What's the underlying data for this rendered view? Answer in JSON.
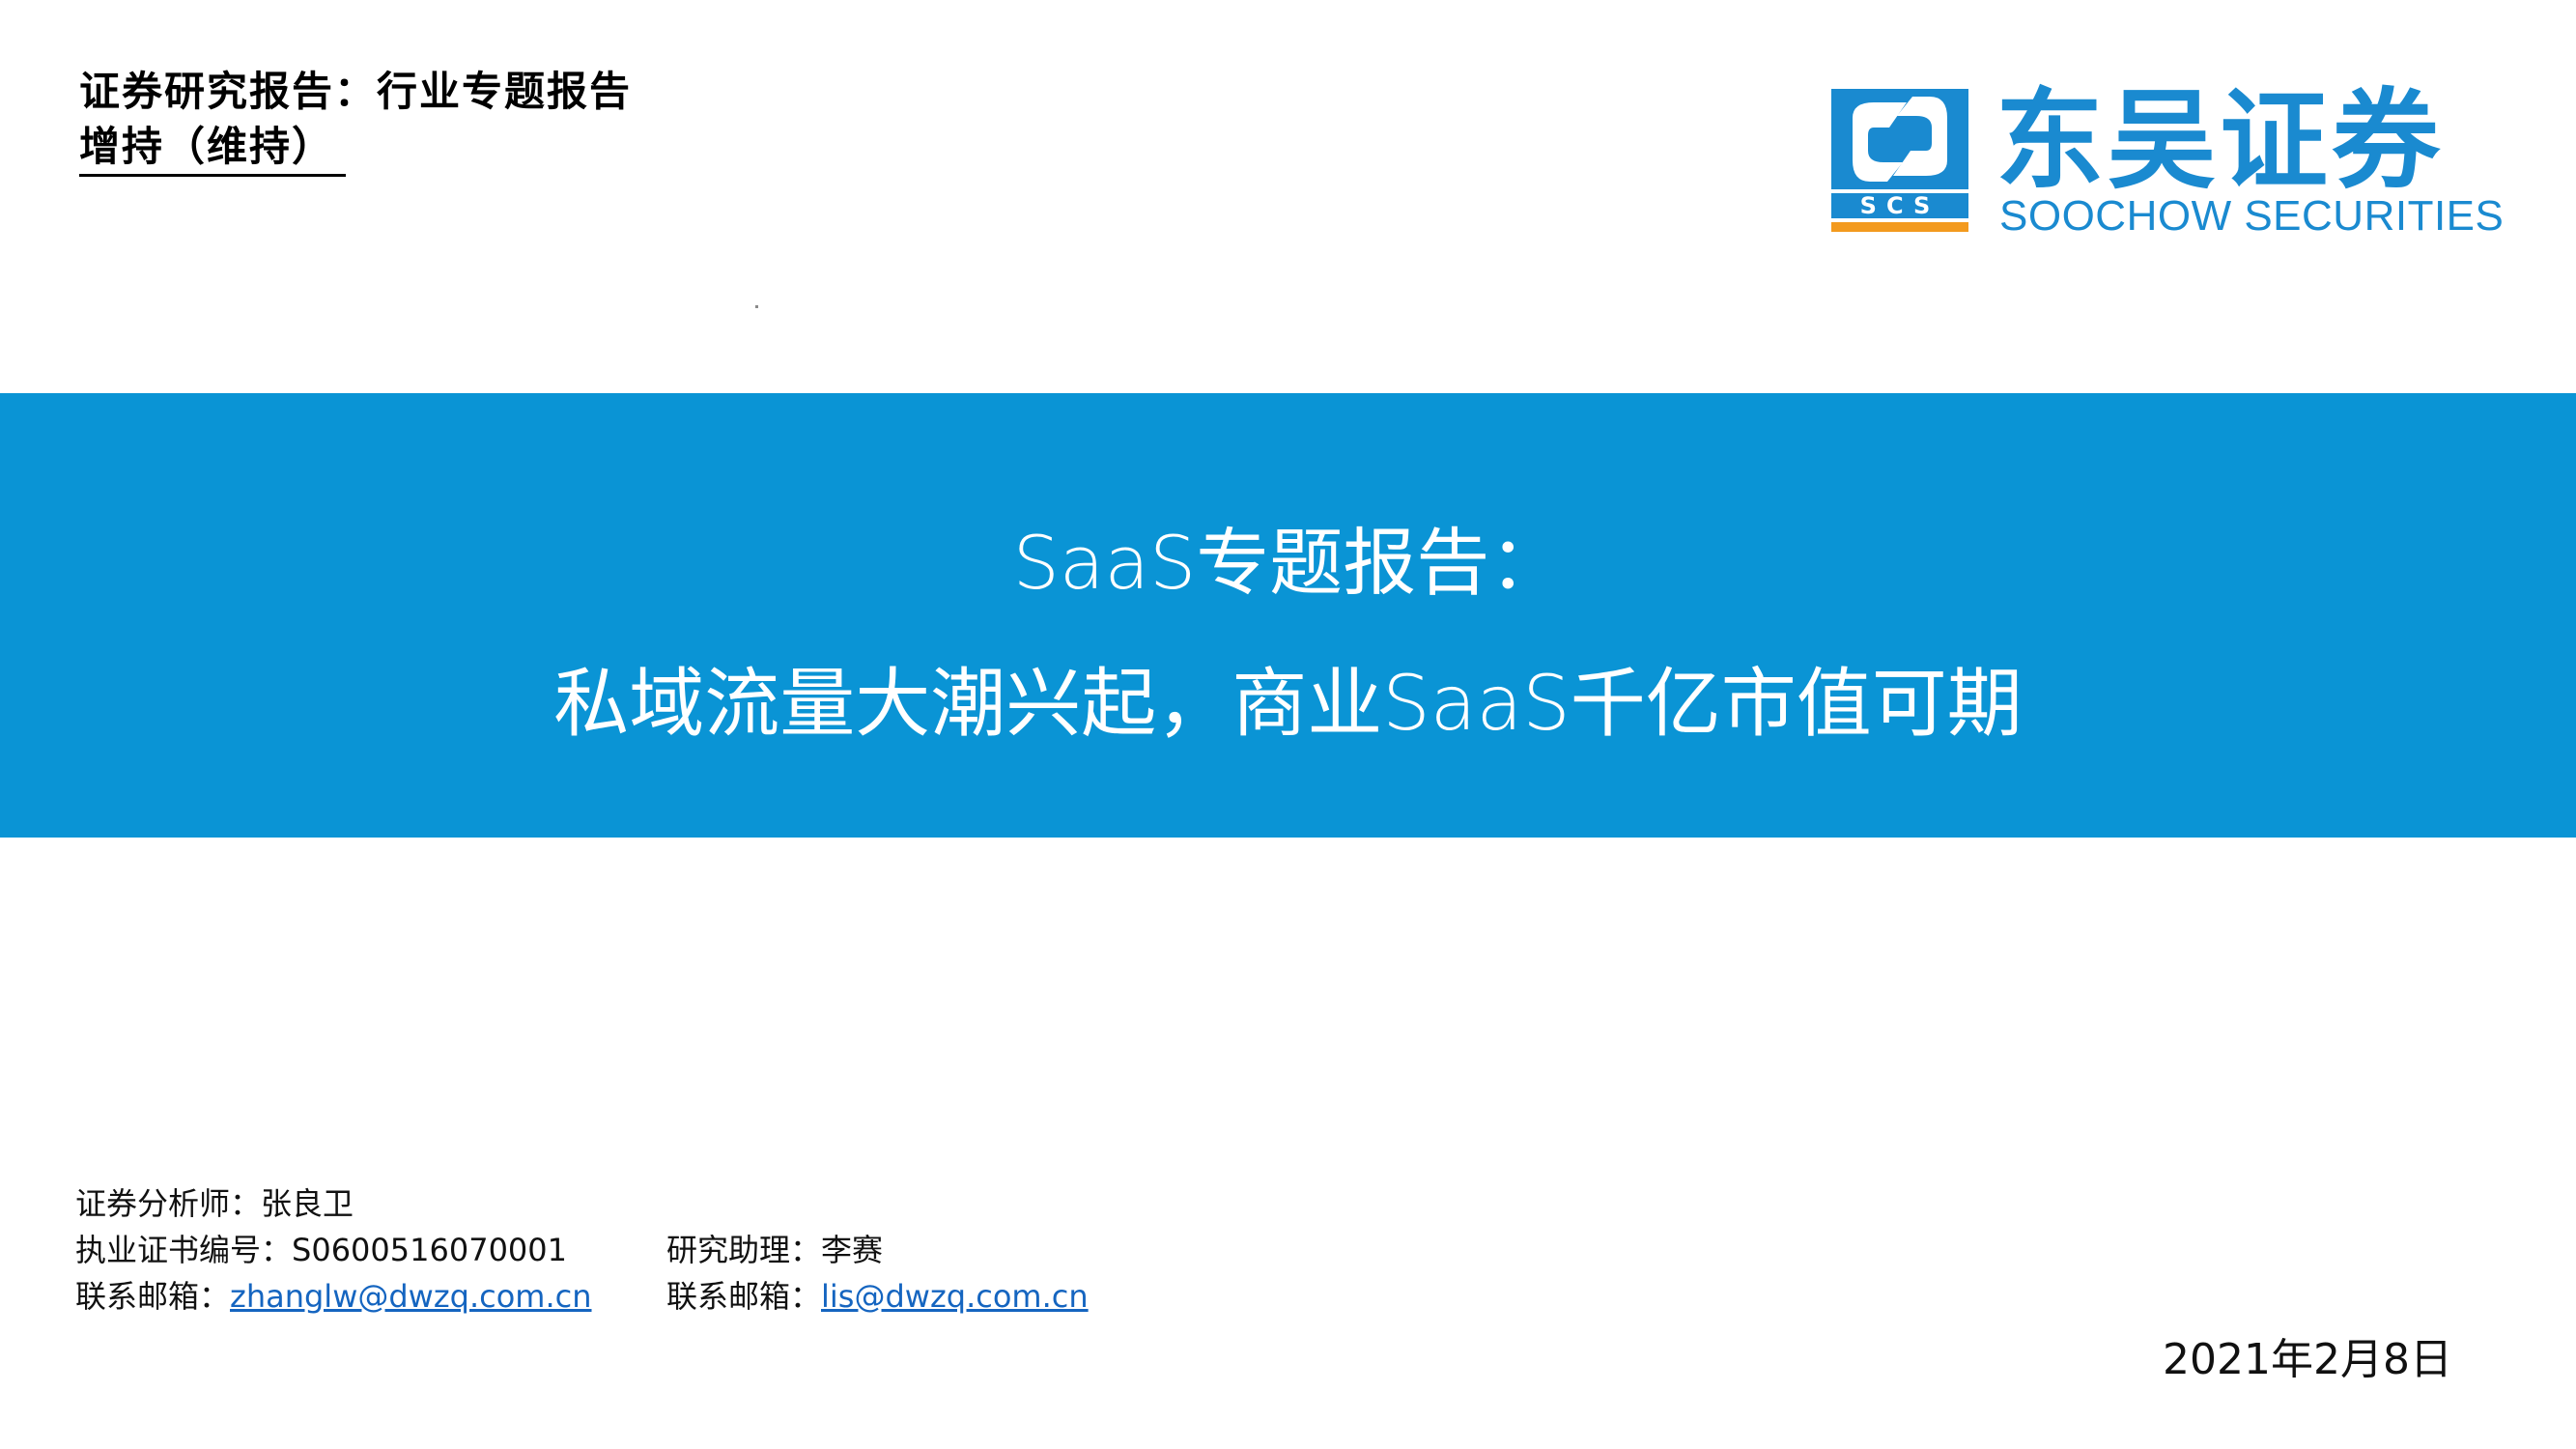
{
  "header": {
    "report_type": "证券研究报告：行业专题报告",
    "rating": "增持（维持）"
  },
  "logo": {
    "cn_name": "东吴证券",
    "en_name": "SOOCHOW SECURITIES",
    "abbr": "SCS",
    "brand_color": "#1a8ad0",
    "accent_color": "#f39a1e"
  },
  "banner": {
    "color": "#0a94d5",
    "title_line1": "SaaS专题报告：",
    "title_line2": "私域流量大潮兴起，商业SaaS千亿市值可期"
  },
  "analyst": {
    "name_label": "证券分析师：",
    "name": "张良卫",
    "cert_label": "执业证书编号：",
    "cert_no": "S0600516070001",
    "email_label": "联系邮箱：",
    "email": "zhanglw@dwzq.com.cn"
  },
  "assistant": {
    "name_label": "研究助理：",
    "name": "李赛",
    "email_label": "联系邮箱：",
    "email": "lis@dwzq.com.cn"
  },
  "date": "2021年2月8日"
}
